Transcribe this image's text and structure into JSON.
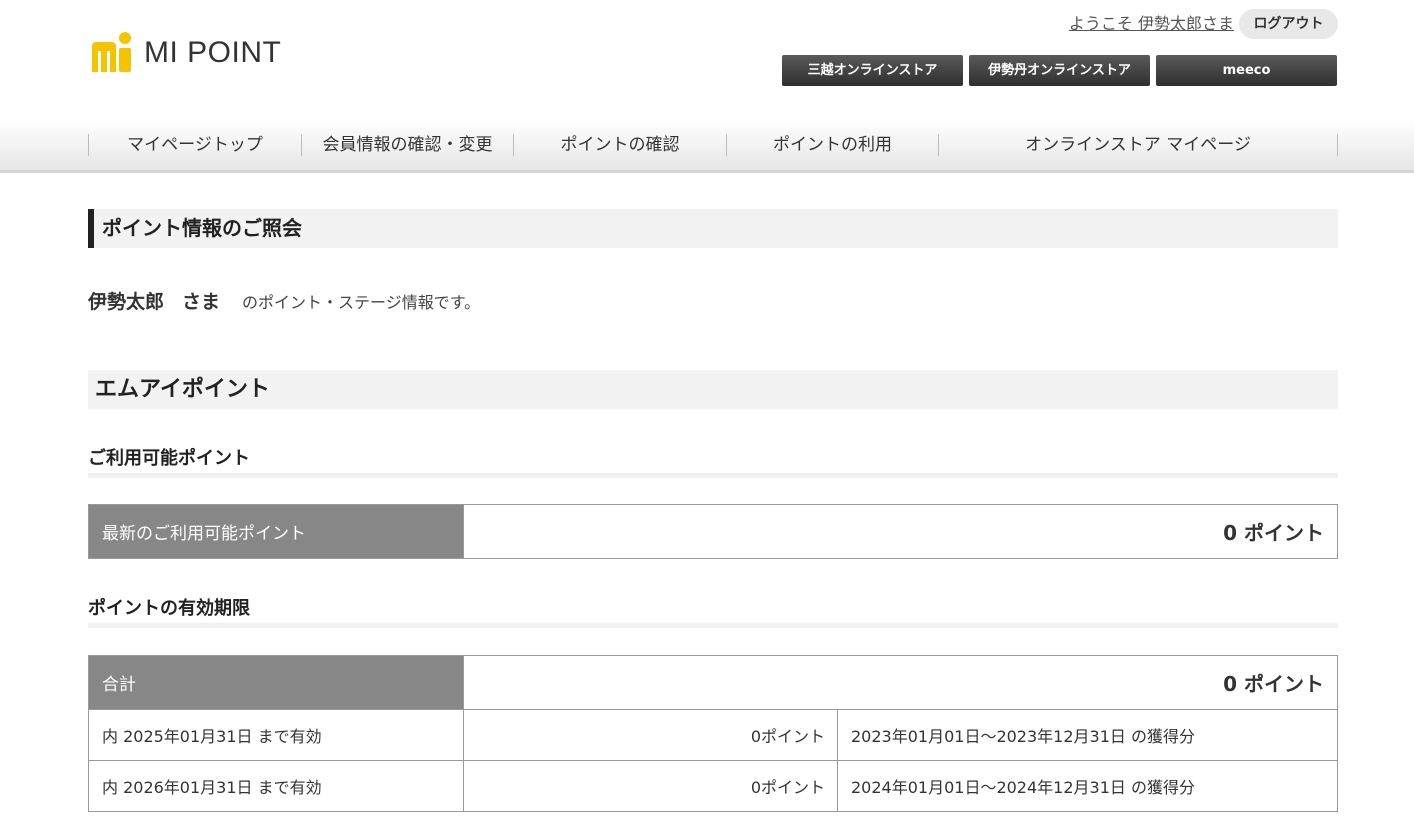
{
  "header": {
    "logo_text": "MI POINT",
    "welcome": "ようこそ 伊勢太郎さま",
    "logout_label": "ログアウト",
    "stores": [
      "三越オンラインストア",
      "伊勢丹オンラインストア",
      "meeco"
    ]
  },
  "nav": {
    "items": [
      "マイページトップ",
      "会員情報の確認・変更",
      "ポイントの確認",
      "ポイントの利用",
      "オンラインストア マイページ"
    ]
  },
  "page": {
    "title": "ポイント情報のご照会",
    "user_name": "伊勢太郎",
    "honorific": "さま",
    "intro_text": "のポイント・ステージ情報です。",
    "section_title": "エムアイポイント"
  },
  "available": {
    "heading": "ご利用可能ポイント",
    "label": "最新のご利用可能ポイント",
    "value": "0 ポイント"
  },
  "expiry": {
    "heading": "ポイントの有効期限",
    "total_label": "合計",
    "total_value": "0 ポイント",
    "rows": [
      {
        "label": "内 2025年01月31日 まで有効",
        "points": "0ポイント",
        "period": "2023年01月01日～2023年12月31日 の獲得分"
      },
      {
        "label": "内 2026年01月31日 まで有効",
        "points": "0ポイント",
        "period": "2024年01月01日～2024年12月31日 の獲得分"
      }
    ]
  },
  "colors": {
    "logo_yellow": "#f5c400",
    "table_header_bg": "#878787",
    "store_button_bg": "#3c3c3c"
  }
}
